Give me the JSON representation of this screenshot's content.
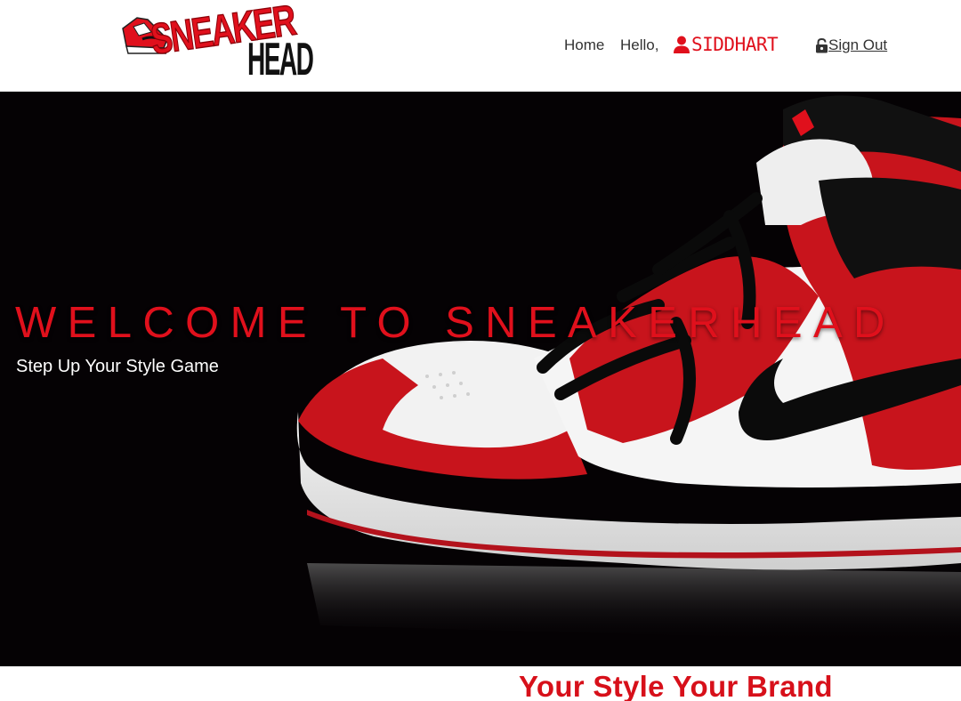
{
  "brand": {
    "logo_line1": "SNEAKER",
    "logo_line2": "HEAD"
  },
  "nav": {
    "home": "Home",
    "greeting": "Hello,",
    "username": "SIDDHART",
    "sign_out": " Sign Out"
  },
  "hero": {
    "title": "WELCOME TO SNEAKERHEAD",
    "subtitle": "Step Up Your Style Game"
  },
  "banner": {
    "tagline": "Your Style Your Brand"
  },
  "colors": {
    "accent": "#e0101c",
    "hero_bg": "#050204",
    "text": "#333333"
  },
  "icons": [
    "sneaker-logo-icon",
    "user-icon",
    "lock-icon"
  ]
}
